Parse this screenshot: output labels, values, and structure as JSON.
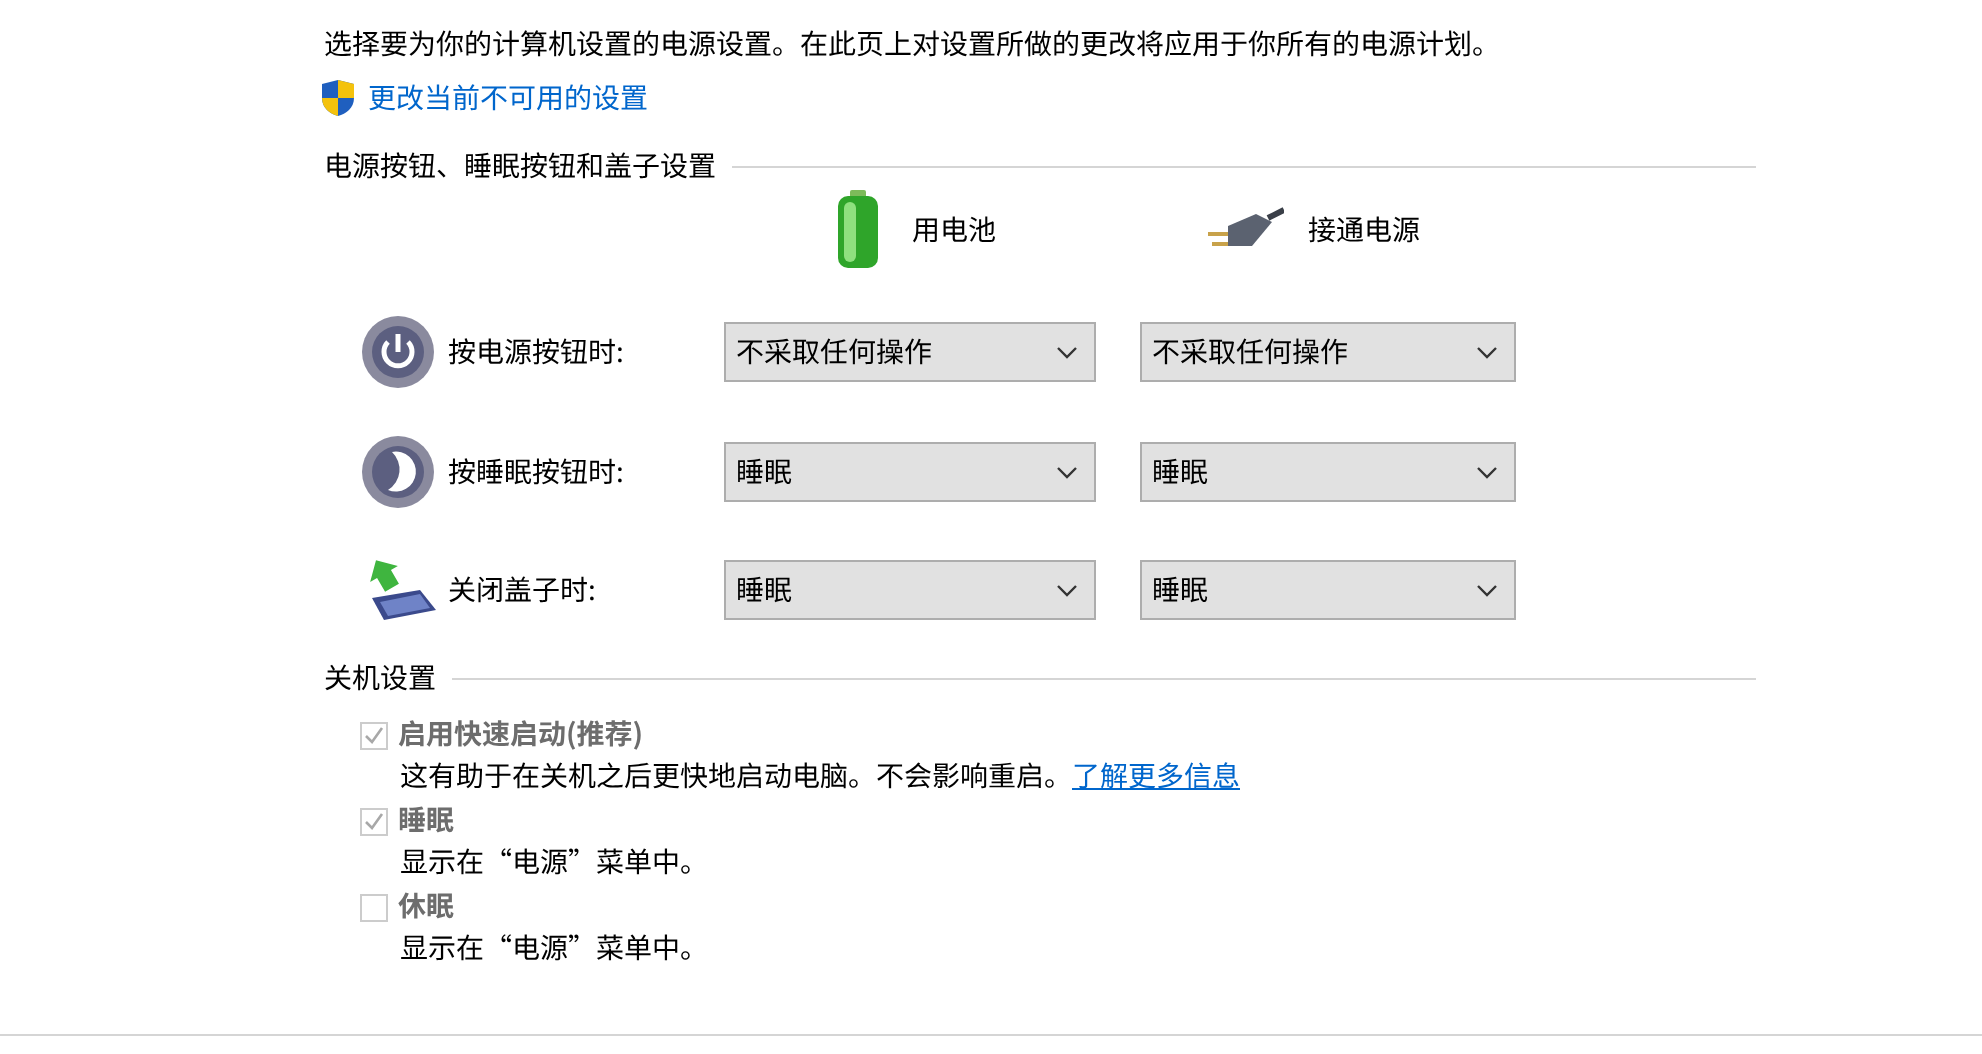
{
  "intro": "选择要为你的计算机设置的电源设置。在此页上对设置所做的更改将应用于你所有的电源计划。",
  "admin_link": "更改当前不可用的设置",
  "buttons_section": {
    "title": "电源按钮、睡眠按钮和盖子设置",
    "columns": [
      {
        "kind": "battery",
        "label": "用电池"
      },
      {
        "kind": "plug",
        "label": "接通电源"
      }
    ],
    "rows": [
      {
        "kind": "power",
        "label": "按电源按钮时:",
        "values": [
          "不采取任何操作",
          "不采取任何操作"
        ]
      },
      {
        "kind": "sleep",
        "label": "按睡眠按钮时:",
        "values": [
          "睡眠",
          "睡眠"
        ]
      },
      {
        "kind": "lid",
        "label": "关闭盖子时:",
        "values": [
          "睡眠",
          "睡眠"
        ]
      }
    ]
  },
  "shutdown_section": {
    "title": "关机设置",
    "options": [
      {
        "label": "启用快速启动(推荐)",
        "checked": true,
        "disabled": true,
        "description": "这有助于在关机之后更快地启动电脑。不会影响重启。",
        "link": "了解更多信息"
      },
      {
        "label": "睡眠",
        "checked": true,
        "disabled": true,
        "description": "显示在“电源”菜单中。"
      },
      {
        "label": "休眠",
        "checked": false,
        "disabled": true,
        "description": "显示在“电源”菜单中。"
      }
    ]
  }
}
